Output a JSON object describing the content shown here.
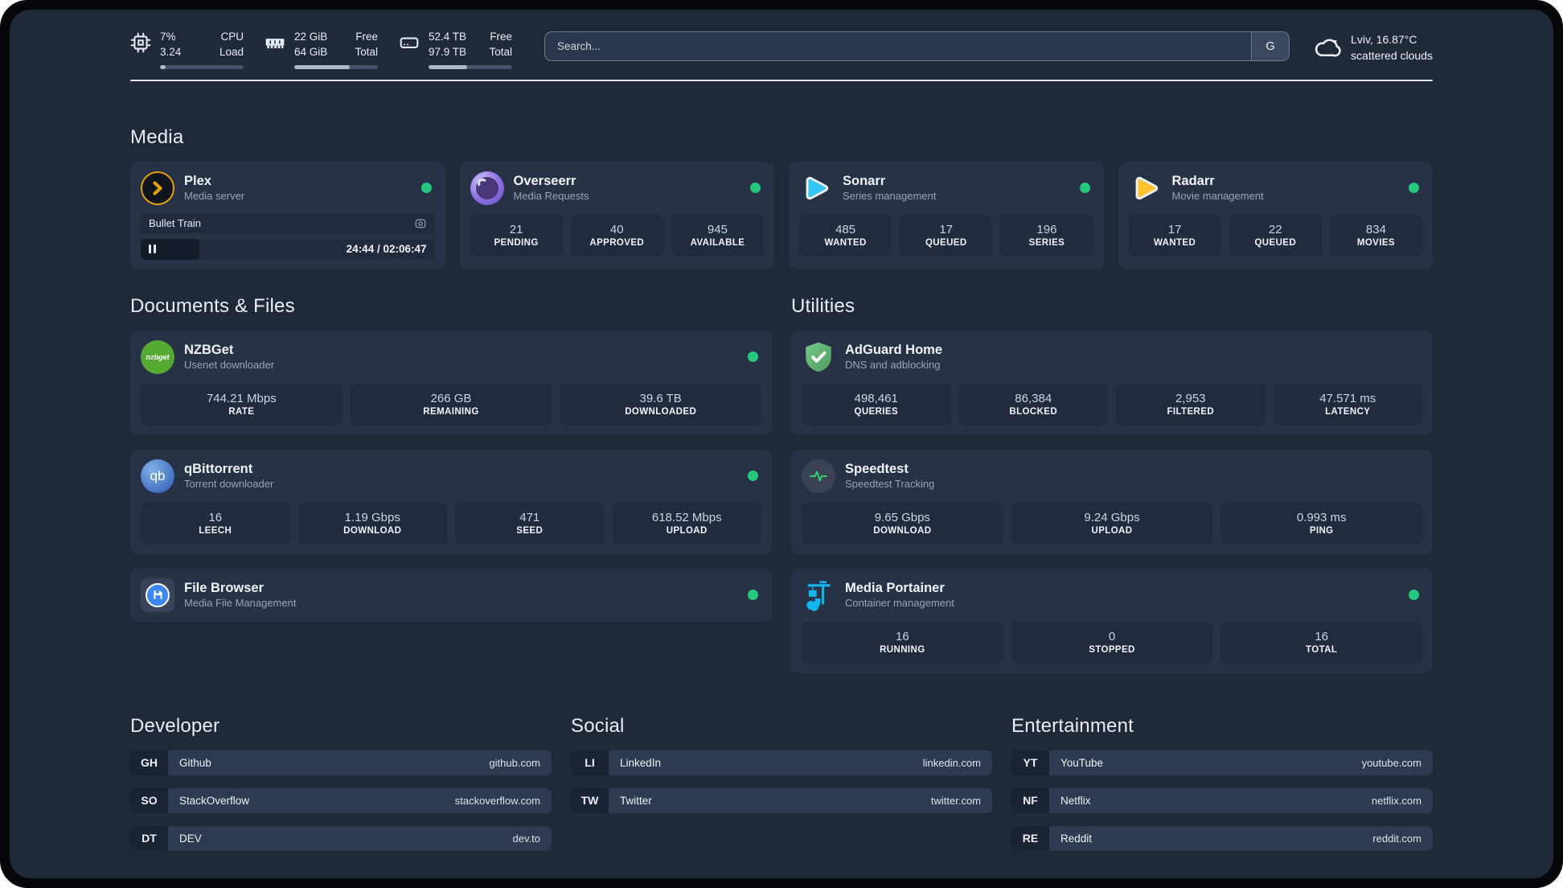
{
  "search": {
    "placeholder": "Search...",
    "engine_label": "G"
  },
  "system": {
    "cpu": {
      "value_1": "7%",
      "value_2": "3.24",
      "label_1": "CPU",
      "label_2": "Load",
      "progress_pct": 7
    },
    "memory": {
      "value_1": "22 GiB",
      "value_2": "64 GiB",
      "label_1": "Free",
      "label_2": "Total",
      "progress_pct": 66
    },
    "disk": {
      "value_1": "52.4 TB",
      "value_2": "97.9 TB",
      "label_1": "Free",
      "label_2": "Total",
      "progress_pct": 46
    }
  },
  "weather": {
    "location": "Lviv, 16.87°C",
    "condition": "scattered clouds"
  },
  "media": {
    "title": "Media",
    "plex": {
      "name": "Plex",
      "desc": "Media server",
      "now_playing": "Bullet Train",
      "elapsed_total": "24:44 / 02:06:47",
      "progress_pct": 20
    },
    "overseerr": {
      "name": "Overseerr",
      "desc": "Media Requests",
      "stats": [
        {
          "value": "21",
          "label": "PENDING"
        },
        {
          "value": "40",
          "label": "APPROVED"
        },
        {
          "value": "945",
          "label": "AVAILABLE"
        }
      ]
    },
    "sonarr": {
      "name": "Sonarr",
      "desc": "Series management",
      "stats": [
        {
          "value": "485",
          "label": "WANTED"
        },
        {
          "value": "17",
          "label": "QUEUED"
        },
        {
          "value": "196",
          "label": "SERIES"
        }
      ]
    },
    "radarr": {
      "name": "Radarr",
      "desc": "Movie management",
      "stats": [
        {
          "value": "17",
          "label": "WANTED"
        },
        {
          "value": "22",
          "label": "QUEUED"
        },
        {
          "value": "834",
          "label": "MOVIES"
        }
      ]
    }
  },
  "documents": {
    "title": "Documents & Files",
    "nzbget": {
      "name": "NZBGet",
      "desc": "Usenet downloader",
      "icon_text": "nzbget",
      "stats": [
        {
          "value": "744.21 Mbps",
          "label": "RATE"
        },
        {
          "value": "266 GB",
          "label": "REMAINING"
        },
        {
          "value": "39.6 TB",
          "label": "DOWNLOADED"
        }
      ]
    },
    "qbittorrent": {
      "name": "qBittorrent",
      "desc": "Torrent downloader",
      "icon_text": "qb",
      "stats": [
        {
          "value": "16",
          "label": "LEECH"
        },
        {
          "value": "1.19 Gbps",
          "label": "DOWNLOAD"
        },
        {
          "value": "471",
          "label": "SEED"
        },
        {
          "value": "618.52 Mbps",
          "label": "UPLOAD"
        }
      ]
    },
    "filebrowser": {
      "name": "File Browser",
      "desc": "Media File Management"
    }
  },
  "utilities": {
    "title": "Utilities",
    "adguard": {
      "name": "AdGuard Home",
      "desc": "DNS and adblocking",
      "stats": [
        {
          "value": "498,461",
          "label": "QUERIES"
        },
        {
          "value": "86,384",
          "label": "BLOCKED"
        },
        {
          "value": "2,953",
          "label": "FILTERED"
        },
        {
          "value": "47.571 ms",
          "label": "LATENCY"
        }
      ]
    },
    "speedtest": {
      "name": "Speedtest",
      "desc": "Speedtest Tracking",
      "stats": [
        {
          "value": "9.65 Gbps",
          "label": "DOWNLOAD"
        },
        {
          "value": "9.24 Gbps",
          "label": "UPLOAD"
        },
        {
          "value": "0.993 ms",
          "label": "PING"
        }
      ]
    },
    "portainer": {
      "name": "Media Portainer",
      "desc": "Container management",
      "stats": [
        {
          "value": "16",
          "label": "RUNNING"
        },
        {
          "value": "0",
          "label": "STOPPED"
        },
        {
          "value": "16",
          "label": "TOTAL"
        }
      ]
    }
  },
  "links": {
    "developer": {
      "title": "Developer",
      "items": [
        {
          "abbr": "GH",
          "name": "Github",
          "url": "github.com"
        },
        {
          "abbr": "SO",
          "name": "StackOverflow",
          "url": "stackoverflow.com"
        },
        {
          "abbr": "DT",
          "name": "DEV",
          "url": "dev.to"
        }
      ]
    },
    "social": {
      "title": "Social",
      "items": [
        {
          "abbr": "LI",
          "name": "LinkedIn",
          "url": "linkedin.com"
        },
        {
          "abbr": "TW",
          "name": "Twitter",
          "url": "twitter.com"
        }
      ]
    },
    "entertainment": {
      "title": "Entertainment",
      "items": [
        {
          "abbr": "YT",
          "name": "YouTube",
          "url": "youtube.com"
        },
        {
          "abbr": "NF",
          "name": "Netflix",
          "url": "netflix.com"
        },
        {
          "abbr": "RE",
          "name": "Reddit",
          "url": "reddit.com"
        }
      ]
    }
  },
  "colors": {
    "status_green": "#25c87d",
    "plex_orange": "#e5a00d",
    "sonarr_blue": "#35c5f4",
    "radarr_yellow": "#ffc230",
    "nzbget_green": "#55a832",
    "qbittorrent_blue": "#3f6fc0",
    "adguard_green": "#67c27a",
    "portainer_blue": "#13b5ea",
    "speedtest_green": "#2dd673"
  }
}
